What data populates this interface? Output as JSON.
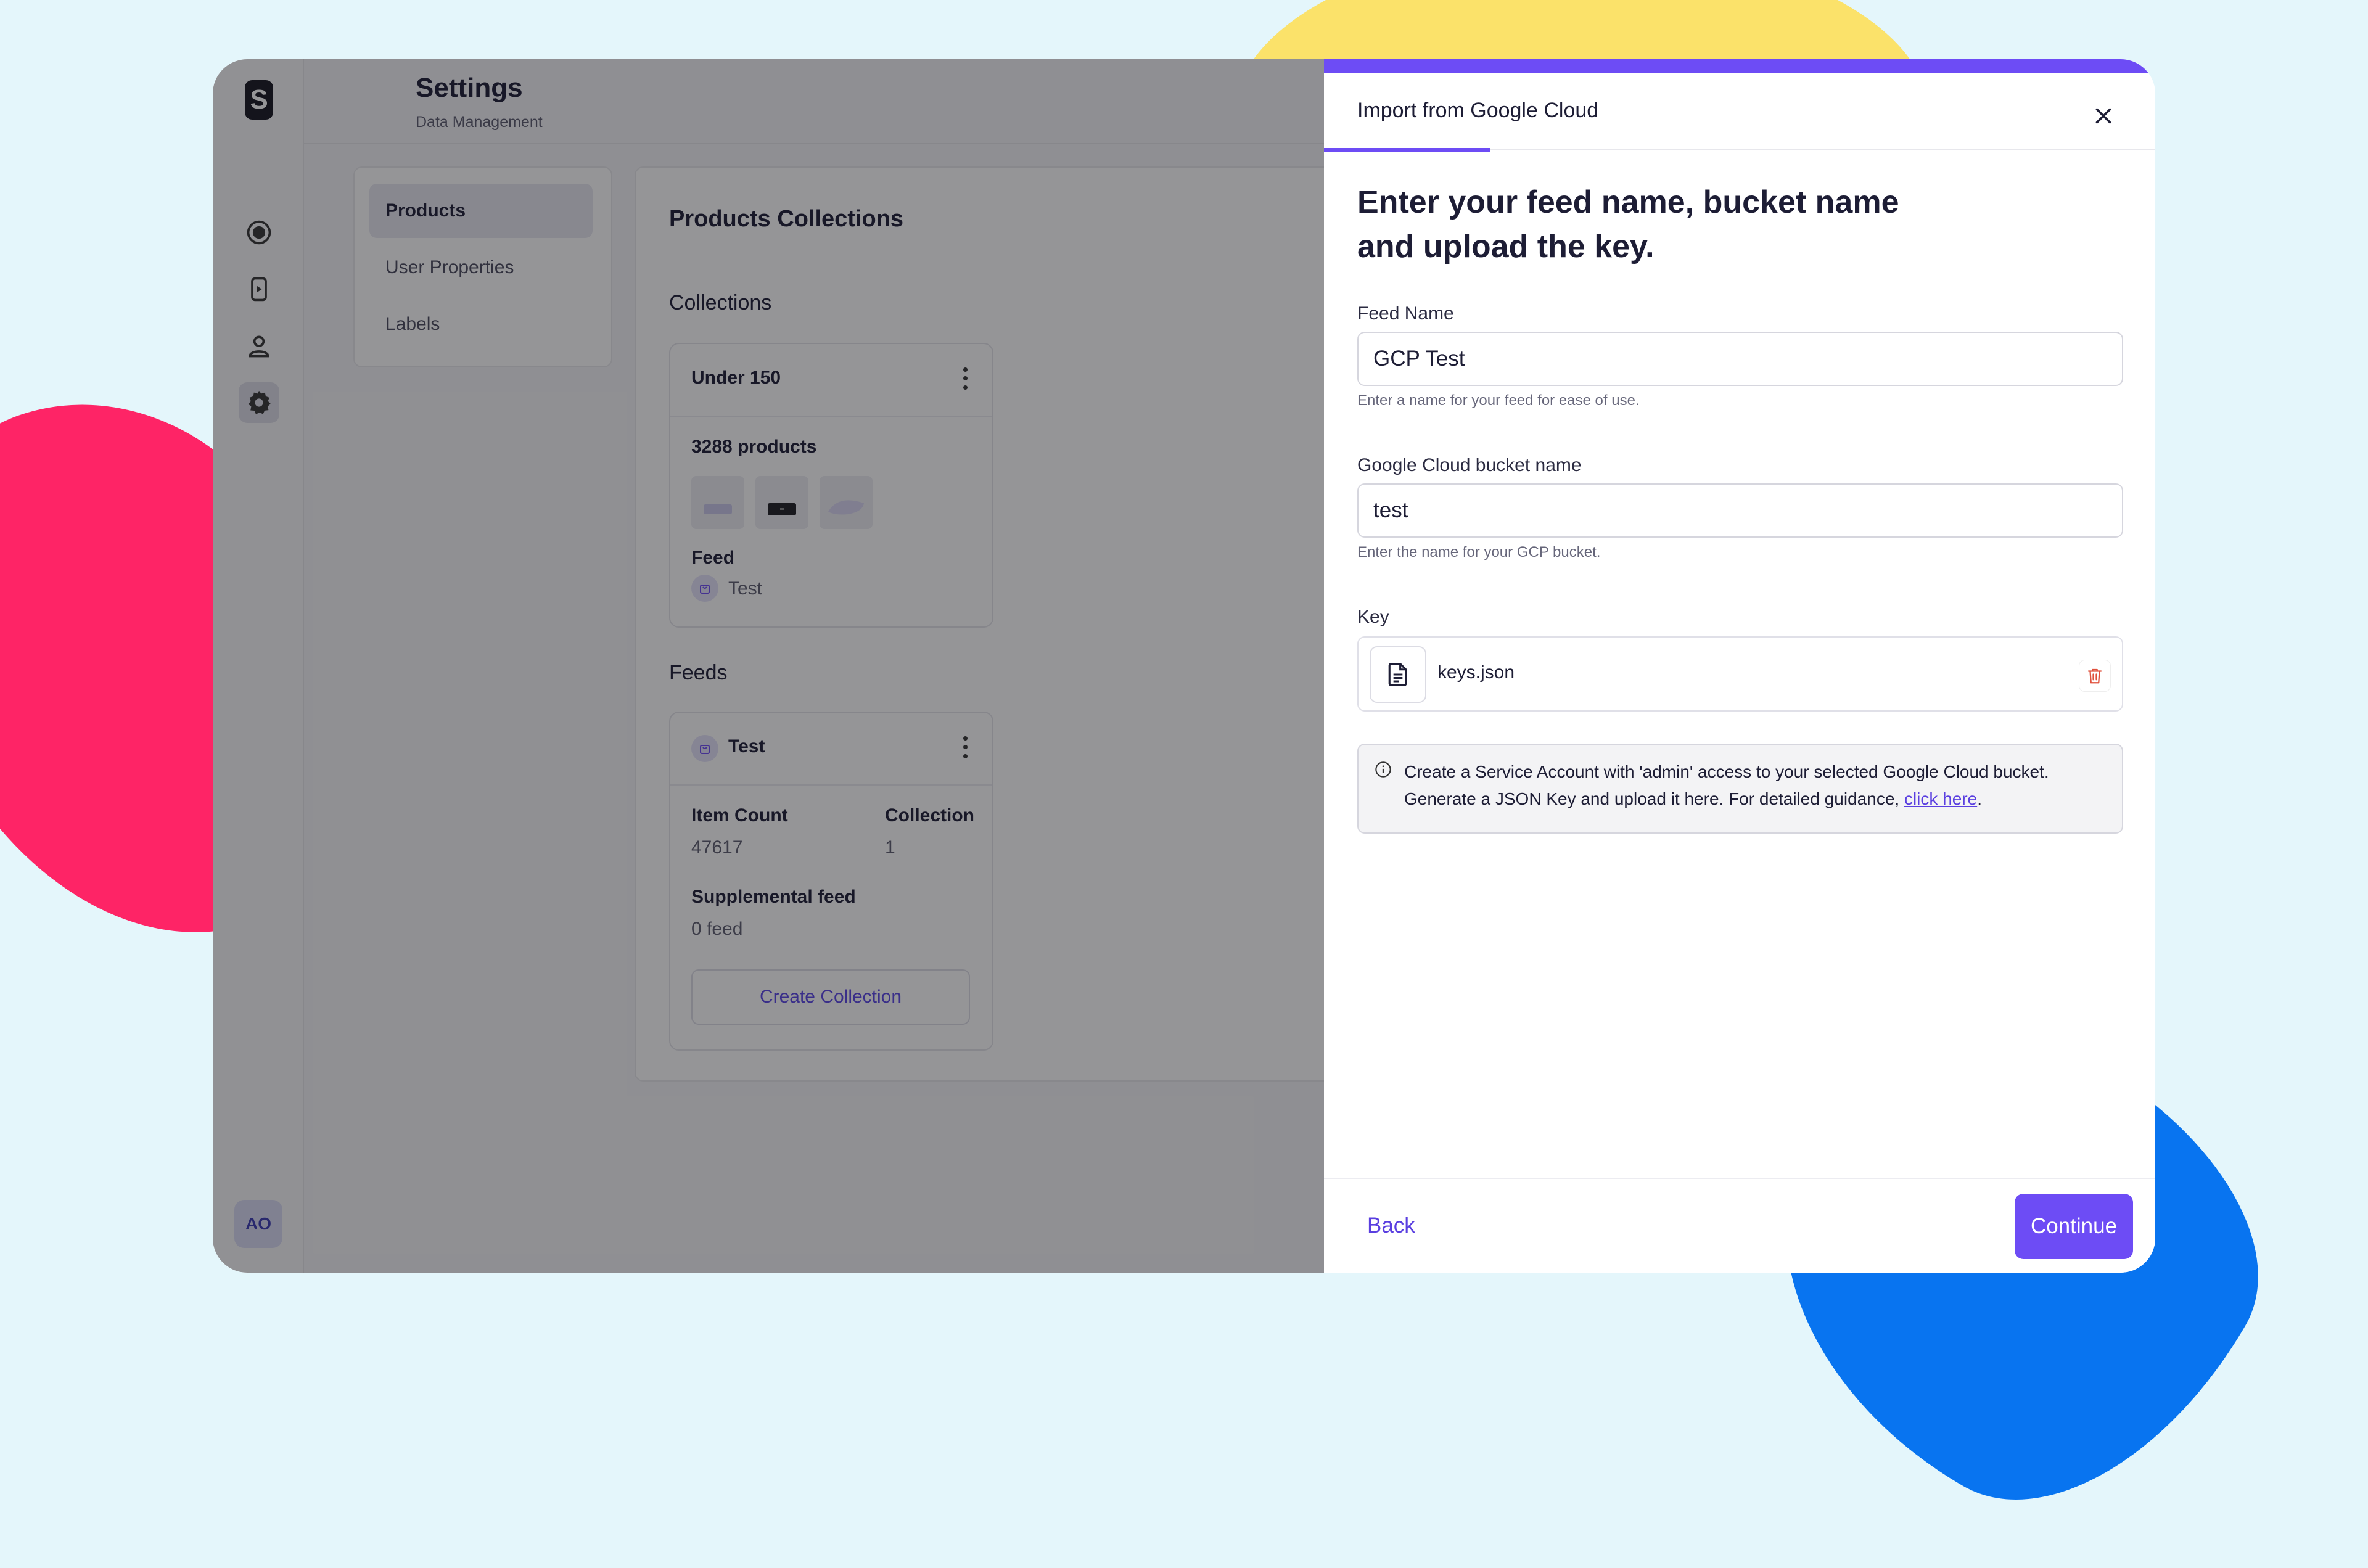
{
  "colors": {
    "accent": "#6d4cf5",
    "link": "#5a3fe0",
    "delete_icon": "#e0503c",
    "background": "#e4f6fb",
    "blob_yellow": "#fbe26a",
    "blob_pink": "#fe2466",
    "blob_blue": "#0874f0"
  },
  "rail": {
    "logo": "S",
    "icons": [
      "record-icon",
      "media-icon",
      "user-icon",
      "gear-icon"
    ],
    "active_icon": "gear-icon",
    "avatar": "AO"
  },
  "header": {
    "title": "Settings",
    "subtitle": "Data Management"
  },
  "settings_nav": {
    "items": [
      "Products",
      "User Properties",
      "Labels"
    ],
    "active": "Products"
  },
  "products": {
    "title": "Products Collections",
    "collections_label": "Collections",
    "collection_card": {
      "name": "Under 150",
      "count": "3288 products",
      "feed_label": "Feed",
      "feed_name": "Test"
    },
    "feeds_label": "Feeds",
    "feed_card": {
      "name": "Test",
      "item_count_label": "Item Count",
      "item_count": "47617",
      "collection_label": "Collection",
      "collection_value": "1",
      "supplemental_label": "Supplemental feed",
      "supplemental_value": "0 feed",
      "create_button": "Create Collection"
    }
  },
  "modal": {
    "tab": "Import from Google Cloud",
    "heading_line1": "Enter your feed name, bucket name",
    "heading_line2": "and upload the key.",
    "feed_name": {
      "label": "Feed Name",
      "value": "GCP Test",
      "help": "Enter a name for your feed for ease of use."
    },
    "bucket": {
      "label": "Google Cloud bucket name",
      "value": "test",
      "help": "Enter the name for your GCP bucket."
    },
    "key": {
      "label": "Key",
      "filename": "keys.json"
    },
    "info": {
      "line1": "Create a Service Account with 'admin' access to your selected Google Cloud bucket.",
      "line2_prefix": "Generate a JSON Key and upload it here. For detailed guidance, ",
      "link_text": "click here",
      "line2_suffix": "."
    },
    "back_button": "Back",
    "continue_button": "Continue"
  }
}
